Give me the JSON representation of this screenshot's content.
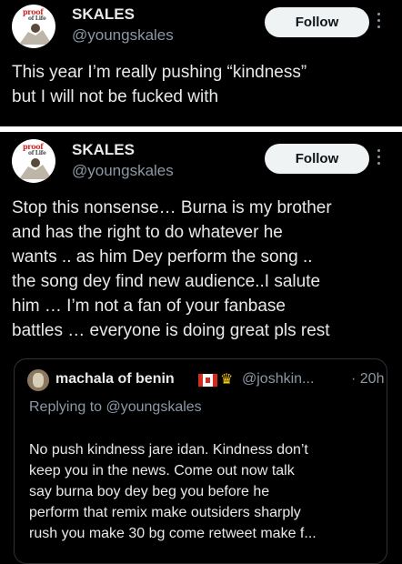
{
  "tweets": [
    {
      "name": "SKALES",
      "handle": "@youngskales",
      "follow_label": "Follow",
      "avatar_brand": "proof",
      "avatar_brand_sub": "of Life",
      "text": "This year I’m really pushing “kindness”\nbut I will not be fucked with"
    },
    {
      "name": "SKALES",
      "handle": "@youngskales",
      "follow_label": "Follow",
      "avatar_brand": "proof",
      "avatar_brand_sub": "of Life",
      "text": "Stop this nonsense… Burna is my brother\nand has the right to do whatever he\nwants .. as him Dey perform the song ..\nthe song dey find new audience..I salute\nhim … I’m not a fan of your fanbase\nbattles … everyone is doing great pls rest",
      "quote": {
        "name": "machala of benin",
        "handle": "@joshkin...",
        "time": "· 20h",
        "replying_to": "Replying to @youngskales",
        "text": "No push kindness jare idan. Kindness don’t\nkeep you in the news.  Come out now talk\nsay burna boy dey beg you before he\nperform that remix make outsiders sharply\nrush you make 30 bg come retweet make f..."
      }
    }
  ],
  "icons": {
    "more": "more-vertical-icon",
    "flag": "canada-flag-icon",
    "crown": "crown-icon"
  },
  "colors": {
    "background": "#000000",
    "text": "#e7e9ea",
    "secondary_text": "#8b98a5",
    "button_bg": "#eff3f4",
    "separator": "#ffffff"
  }
}
